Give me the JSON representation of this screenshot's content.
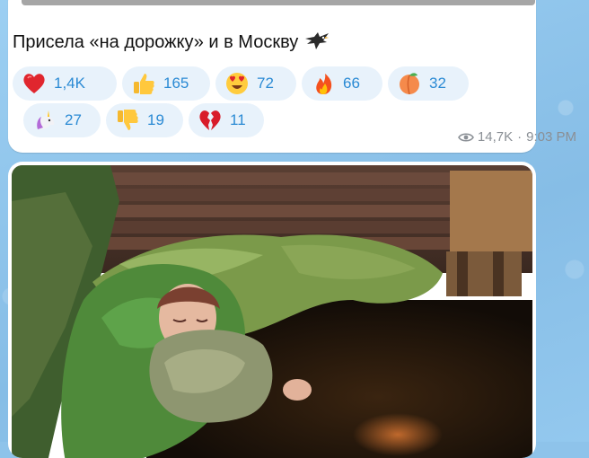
{
  "post": {
    "caption": "Присела «на дорожку» и в Москву",
    "caption_emoji_icon": "eagle-icon",
    "views": "14,7K",
    "separator": "·",
    "time": "9:03 PM"
  },
  "reactions": [
    {
      "icon": "red-heart-icon",
      "count": "1,4K"
    },
    {
      "icon": "thumbs-up-icon",
      "count": "165"
    },
    {
      "icon": "heart-eyes-icon",
      "count": "72"
    },
    {
      "icon": "fire-icon",
      "count": "66"
    },
    {
      "icon": "peach-icon",
      "count": "32"
    },
    {
      "icon": "unicorn-icon",
      "count": "27"
    },
    {
      "icon": "thumbs-down-icon",
      "count": "19"
    },
    {
      "icon": "broken-heart-icon",
      "count": "11"
    }
  ],
  "colors": {
    "chat_background": "#8ec3ea",
    "reaction_pill": "#e8f2fb",
    "reaction_count": "#2a8ad4",
    "meta_text": "#8a8f95"
  }
}
